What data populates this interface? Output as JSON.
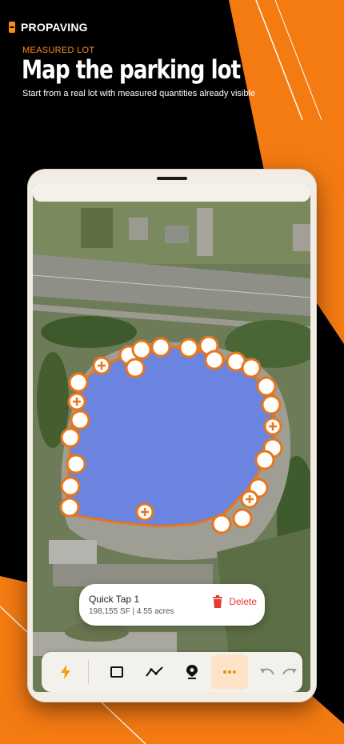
{
  "brand": {
    "name": "PROPAVING",
    "icon": "propaving-logo-icon"
  },
  "hero": {
    "eyebrow": "MEASURED LOT",
    "title": "Map the parking lot",
    "subtitle": "Start from a real lot with measured quantities already visible"
  },
  "colors": {
    "accent": "#ff8a1a",
    "brand_orange": "#f47a12",
    "delete_red": "#e53935",
    "polygon_fill": "#5b7cf5",
    "polygon_stroke": "#e8761a"
  },
  "map": {
    "type": "satellite",
    "polygon": "parking-lot-outline"
  },
  "selection_card": {
    "title": "Quick Tap 1",
    "measurement": "198,155 SF | 4.55 acres",
    "delete_label": "Delete",
    "delete_icon": "trash-icon"
  },
  "toolbar": {
    "tools": [
      {
        "icon": "lightning-icon",
        "name": "quick-tap",
        "active": false
      },
      {
        "icon": "rectangle-icon",
        "name": "rectangle",
        "active": false
      },
      {
        "icon": "polyline-icon",
        "name": "line",
        "active": false
      },
      {
        "icon": "map-pin-icon",
        "name": "point",
        "active": false
      },
      {
        "icon": "more-icon",
        "name": "more",
        "active": true
      },
      {
        "icon": "undo-icon",
        "name": "undo",
        "active": false
      },
      {
        "icon": "redo-icon",
        "name": "redo",
        "active": false
      }
    ]
  }
}
